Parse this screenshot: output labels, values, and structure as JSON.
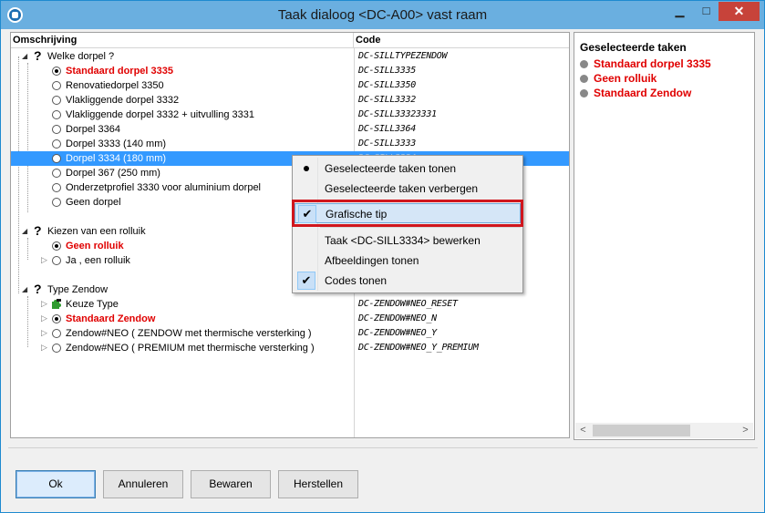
{
  "window": {
    "title": "Taak dialoog <DC-A00> vast raam",
    "minimize_glyph": "▁",
    "maximize_glyph": "□",
    "close_glyph": "✕"
  },
  "tree": {
    "headers": {
      "description": "Omschrijving",
      "code": "Code"
    },
    "groups": [
      {
        "label": "Welke dorpel ?",
        "code": "DC-SILLTYPEZENDOW",
        "items": [
          {
            "label": "Standaard dorpel 3335",
            "code": "DC-SILL3335",
            "checked": true,
            "bold_red": true
          },
          {
            "label": "Renovatiedorpel 3350",
            "code": "DC-SILL3350",
            "checked": false
          },
          {
            "label": "Vlakliggende dorpel 3332",
            "code": "DC-SILL3332",
            "checked": false
          },
          {
            "label": "Vlakliggende dorpel 3332 + uitvulling 3331",
            "code": "DC-SILL33323331",
            "checked": false
          },
          {
            "label": "Dorpel 3364",
            "code": "DC-SILL3364",
            "checked": false
          },
          {
            "label": "Dorpel 3333 (140 mm)",
            "code": "DC-SILL3333",
            "checked": false
          },
          {
            "label": "Dorpel 3334 (180 mm)",
            "code": "DC-SILL3334",
            "checked": false,
            "selected": true
          },
          {
            "label": "Dorpel 367 (250 mm)",
            "code": "",
            "checked": false
          },
          {
            "label": "Onderzetprofiel 3330 voor aluminium dorpel",
            "code": "",
            "checked": false
          },
          {
            "label": "Geen dorpel",
            "code": "",
            "checked": false
          }
        ]
      },
      {
        "label": "Kiezen van een rolluik",
        "items": [
          {
            "label": "Geen rolluik",
            "code": "",
            "checked": true,
            "bold_red": true
          },
          {
            "label": "Ja , een rolluik",
            "code": "",
            "checked": false
          }
        ]
      },
      {
        "label": "Type Zendow",
        "items": [
          {
            "label": "Keuze Type",
            "code": "DC-ZENDOW#NEO_RESET",
            "puzzle": true
          },
          {
            "label": "Standaard Zendow",
            "code": "DC-ZENDOW#NEO_N",
            "checked": true,
            "bold_red": true
          },
          {
            "label": "Zendow#NEO ( ZENDOW met thermische versterking )",
            "code": "DC-ZENDOW#NEO_Y",
            "checked": false
          },
          {
            "label": "Zendow#NEO ( PREMIUM met thermische versterking )",
            "code": "DC-ZENDOW#NEO_Y_PREMIUM",
            "checked": false
          }
        ]
      }
    ]
  },
  "selected_tasks": {
    "title": "Geselecteerde taken",
    "items": [
      "Standaard dorpel 3335",
      "Geen rolluik",
      "Standaard Zendow"
    ],
    "scroll_left": "<",
    "scroll_right": ">"
  },
  "context_menu": {
    "items": [
      {
        "label": "Geselecteerde taken tonen",
        "mark": "bullet"
      },
      {
        "label": "Geselecteerde taken verbergen",
        "mark": ""
      },
      {
        "label": "Grafische tip",
        "mark": "check",
        "highlighted": true
      },
      {
        "label": "Taak <DC-SILL3334> bewerken",
        "mark": ""
      },
      {
        "label": "Afbeeldingen tonen",
        "mark": ""
      },
      {
        "label": "Codes tonen",
        "mark": "check"
      }
    ],
    "check_glyph": "✔",
    "highlight_color": "#d0161d"
  },
  "buttons": {
    "ok": "Ok",
    "cancel": "Annuleren",
    "save": "Bewaren",
    "restore": "Herstellen"
  }
}
